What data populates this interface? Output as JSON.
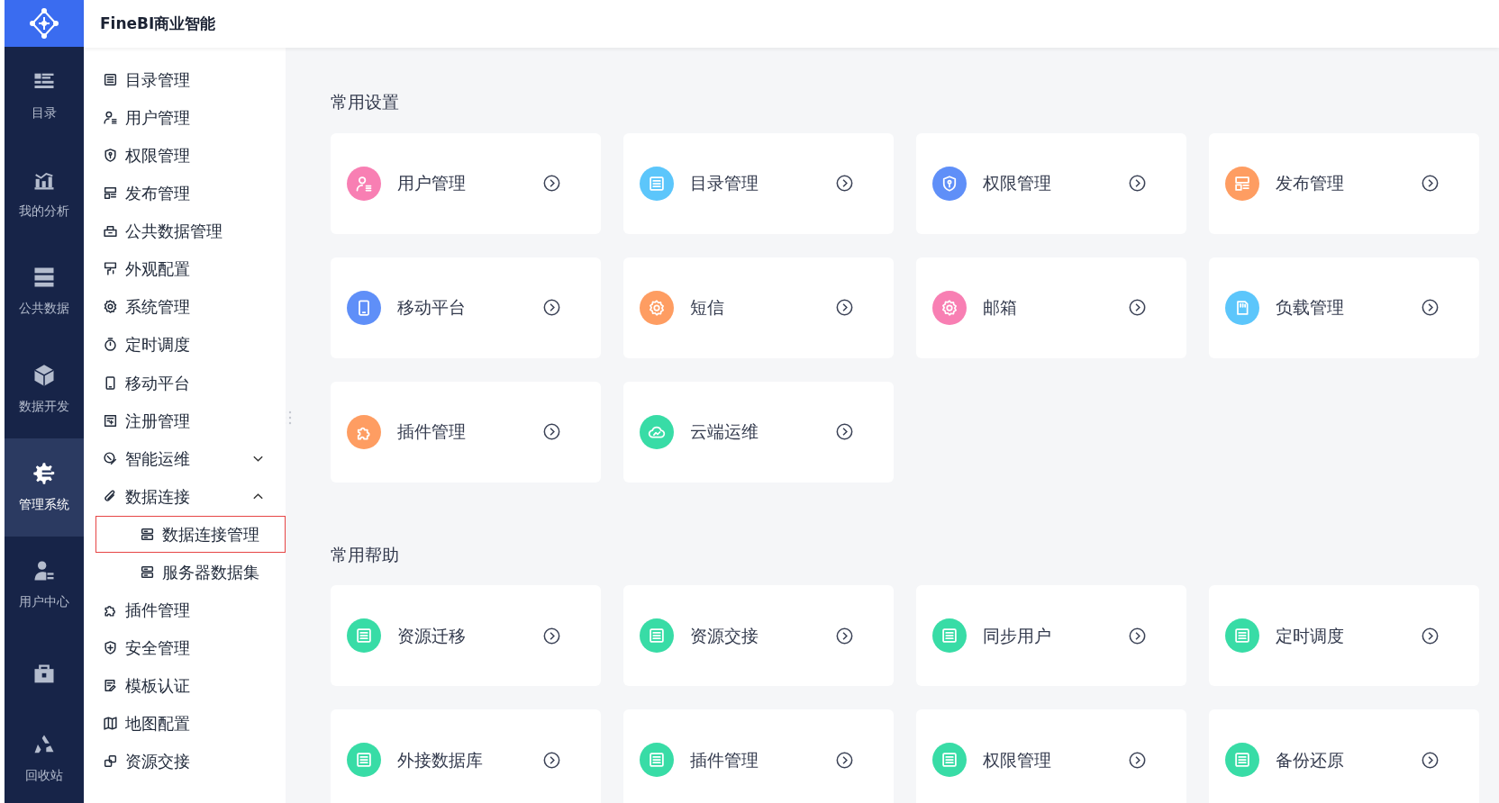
{
  "app": {
    "title": "FineBI商业智能"
  },
  "rail": [
    {
      "label": "目录",
      "selected": false
    },
    {
      "label": "我的分析",
      "selected": false
    },
    {
      "label": "公共数据",
      "selected": false
    },
    {
      "label": "数据开发",
      "selected": false
    },
    {
      "label": "管理系统",
      "selected": true
    },
    {
      "label": "用户中心",
      "selected": false
    },
    {
      "selected": false
    },
    {
      "label": "回收站",
      "selected": false
    }
  ],
  "menu": [
    {
      "label": "目录管理",
      "selected": false
    },
    {
      "label": "用户管理",
      "selected": false
    },
    {
      "label": "权限管理",
      "selected": false
    },
    {
      "label": "发布管理",
      "selected": false
    },
    {
      "label": "公共数据管理",
      "selected": false
    },
    {
      "label": "外观配置",
      "selected": false
    },
    {
      "label": "系统管理",
      "selected": false
    },
    {
      "label": "定时调度",
      "selected": false
    },
    {
      "label": "移动平台",
      "selected": false
    },
    {
      "label": "注册管理",
      "selected": false
    },
    {
      "label": "智能运维",
      "selected": false,
      "expanded": false
    },
    {
      "label": "数据连接",
      "selected": false,
      "expanded": true,
      "children": [
        {
          "label": "数据连接管理",
          "selected": true
        },
        {
          "label": "服务器数据集",
          "selected": false
        }
      ]
    },
    {
      "label": "插件管理",
      "selected": false
    },
    {
      "label": "安全管理",
      "selected": false
    },
    {
      "label": "模板认证",
      "selected": false
    },
    {
      "label": "地图配置",
      "selected": false
    },
    {
      "label": "资源交接",
      "selected": false
    }
  ],
  "sections": [
    {
      "title": "常用设置",
      "cards": [
        {
          "label": "用户管理",
          "kind": "user",
          "color": "#f87fb3"
        },
        {
          "label": "目录管理",
          "kind": "list",
          "color": "#5cc6fb"
        },
        {
          "label": "权限管理",
          "kind": "shield",
          "color": "#5f8ff8"
        },
        {
          "label": "发布管理",
          "kind": "layout",
          "color": "#fe9d62"
        },
        {
          "label": "移动平台",
          "kind": "phone",
          "color": "#5f8ff8"
        },
        {
          "label": "短信",
          "kind": "gear",
          "color": "#fe9d62"
        },
        {
          "label": "邮箱",
          "kind": "gear",
          "color": "#f87fb3"
        },
        {
          "label": "负载管理",
          "kind": "card",
          "color": "#5cc6fb"
        },
        {
          "label": "插件管理",
          "kind": "puzzle",
          "color": "#fe9d62"
        },
        {
          "label": "云端运维",
          "kind": "cloud",
          "color": "#38dca6"
        }
      ]
    },
    {
      "title": "常用帮助",
      "cards": [
        {
          "label": "资源迁移",
          "kind": "list",
          "color": "#38dca6"
        },
        {
          "label": "资源交接",
          "kind": "list",
          "color": "#38dca6"
        },
        {
          "label": "同步用户",
          "kind": "list",
          "color": "#38dca6"
        },
        {
          "label": "定时调度",
          "kind": "list",
          "color": "#38dca6"
        },
        {
          "label": "外接数据库",
          "kind": "list",
          "color": "#38dca6"
        },
        {
          "label": "插件管理",
          "kind": "list",
          "color": "#38dca6"
        },
        {
          "label": "权限管理",
          "kind": "list",
          "color": "#38dca6"
        },
        {
          "label": "备份还原",
          "kind": "list",
          "color": "#38dca6"
        }
      ]
    }
  ]
}
